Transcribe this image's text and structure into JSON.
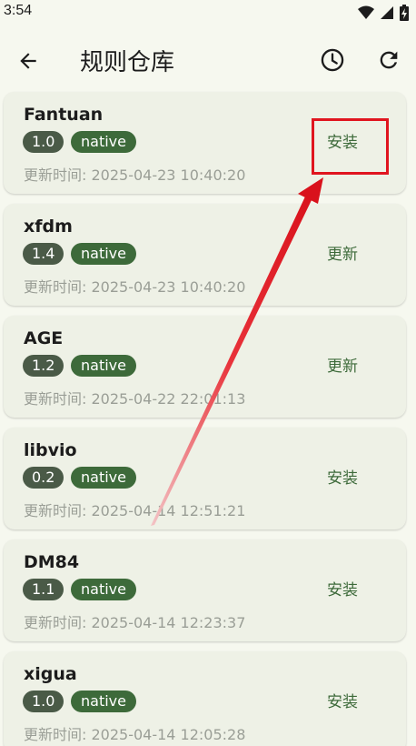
{
  "status_bar": {
    "time": "3:54"
  },
  "app_bar": {
    "title": "规则仓库"
  },
  "repos": [
    {
      "name": "Fantuan",
      "version": "1.0",
      "type": "native",
      "updated": "更新时间: 2025-04-23 10:40:20",
      "action": "安装"
    },
    {
      "name": "xfdm",
      "version": "1.4",
      "type": "native",
      "updated": "更新时间: 2025-04-23 10:40:20",
      "action": "更新"
    },
    {
      "name": "AGE",
      "version": "1.2",
      "type": "native",
      "updated": "更新时间: 2025-04-22 22:01:13",
      "action": "更新"
    },
    {
      "name": "libvio",
      "version": "0.2",
      "type": "native",
      "updated": "更新时间: 2025-04-14 12:51:21",
      "action": "安装"
    },
    {
      "name": "DM84",
      "version": "1.1",
      "type": "native",
      "updated": "更新时间: 2025-04-14 12:23:37",
      "action": "安装"
    },
    {
      "name": "xigua",
      "version": "1.0",
      "type": "native",
      "updated": "更新时间: 2025-04-14 12:05:28",
      "action": "安装"
    }
  ],
  "colors": {
    "background": "#f6f8ef",
    "card": "#eef1e6",
    "accent_green": "#3d6a3a",
    "version_chip": "#4a5a47",
    "annotation_red": "#e0151f"
  }
}
